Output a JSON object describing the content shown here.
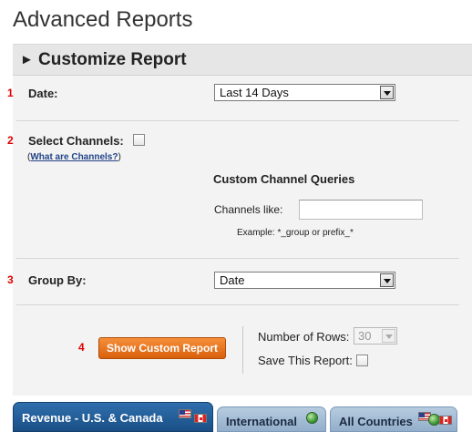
{
  "page": {
    "title": "Advanced Reports"
  },
  "panel": {
    "title": "Customize Report"
  },
  "steps": {
    "s1": "1",
    "s2": "2",
    "s3": "3",
    "s4": "4"
  },
  "date": {
    "label": "Date:",
    "value": "Last 14 Days"
  },
  "channels": {
    "label": "Select Channels:",
    "help_prefix": "(",
    "help_link": "What are Channels?",
    "help_suffix": ")",
    "checked": false
  },
  "custom_queries": {
    "title": "Custom Channel Queries",
    "channels_like_label": "Channels like:",
    "channels_like_value": "",
    "example": "Example: *_group or prefix_*"
  },
  "group_by": {
    "label": "Group By:",
    "value": "Date"
  },
  "actions": {
    "show_report_button": "Show Custom Report",
    "rows_label": "Number of Rows:",
    "rows_value": "30",
    "save_label": "Save This Report:",
    "save_checked": false
  },
  "tabs": [
    {
      "label": "Revenue - U.S. & Canada",
      "active": true
    },
    {
      "label": "International",
      "active": false
    },
    {
      "label": "All Countries",
      "active": false
    }
  ],
  "colors": {
    "accent_orange": "#e8731d",
    "step_number_red": "#dd0000",
    "tab_active_blue": "#245f9c",
    "tab_inactive_blue": "#a6bed6",
    "link_blue": "#224488"
  },
  "icons": {
    "panel_toggle": "triangle-right-icon",
    "us_flag": "us-flag-icon",
    "canada_flag": "canada-flag-icon",
    "globe": "globe-icon"
  }
}
